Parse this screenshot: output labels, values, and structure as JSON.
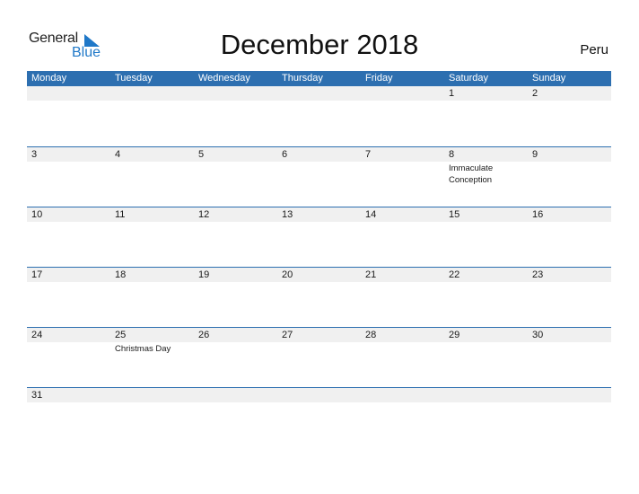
{
  "logo": {
    "line1": "General",
    "line2": "Blue"
  },
  "title": "December 2018",
  "country": "Peru",
  "weekdays": [
    "Monday",
    "Tuesday",
    "Wednesday",
    "Thursday",
    "Friday",
    "Saturday",
    "Sunday"
  ],
  "weeks": [
    [
      {
        "day": ""
      },
      {
        "day": ""
      },
      {
        "day": ""
      },
      {
        "day": ""
      },
      {
        "day": ""
      },
      {
        "day": "1"
      },
      {
        "day": "2"
      }
    ],
    [
      {
        "day": "3"
      },
      {
        "day": "4"
      },
      {
        "day": "5"
      },
      {
        "day": "6"
      },
      {
        "day": "7"
      },
      {
        "day": "8",
        "event": "Immaculate Conception"
      },
      {
        "day": "9"
      }
    ],
    [
      {
        "day": "10"
      },
      {
        "day": "11"
      },
      {
        "day": "12"
      },
      {
        "day": "13"
      },
      {
        "day": "14"
      },
      {
        "day": "15"
      },
      {
        "day": "16"
      }
    ],
    [
      {
        "day": "17"
      },
      {
        "day": "18"
      },
      {
        "day": "19"
      },
      {
        "day": "20"
      },
      {
        "day": "21"
      },
      {
        "day": "22"
      },
      {
        "day": "23"
      }
    ],
    [
      {
        "day": "24"
      },
      {
        "day": "25",
        "event": "Christmas Day"
      },
      {
        "day": "26"
      },
      {
        "day": "27"
      },
      {
        "day": "28"
      },
      {
        "day": "29"
      },
      {
        "day": "30"
      }
    ],
    [
      {
        "day": "31"
      },
      {
        "day": ""
      },
      {
        "day": ""
      },
      {
        "day": ""
      },
      {
        "day": ""
      },
      {
        "day": ""
      },
      {
        "day": ""
      }
    ]
  ],
  "colors": {
    "header": "#2d6fb0",
    "brand_blue": "#1f78c8",
    "day_strip": "#f0f0f0"
  }
}
